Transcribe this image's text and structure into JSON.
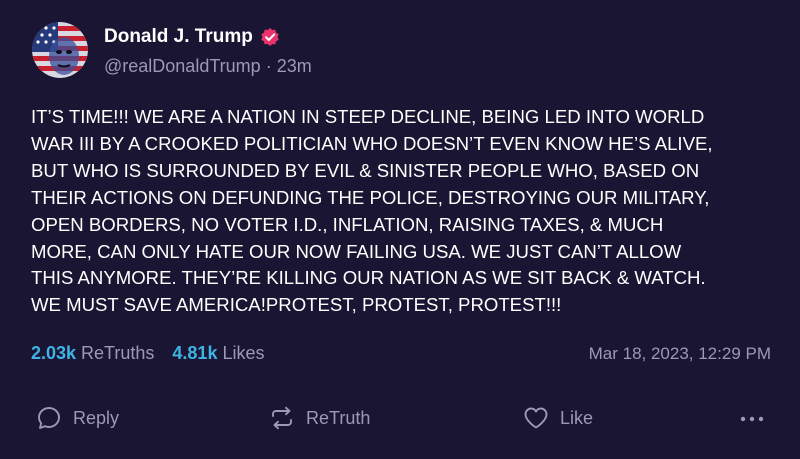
{
  "author": {
    "display_name": "Donald J. Trump",
    "handle": "@realDonaldTrump",
    "separator": "·",
    "relative_time": "23m",
    "verified": true
  },
  "post": {
    "text": "IT’S TIME!!! WE ARE A NATION IN STEEP DECLINE, BEING LED INTO WORLD\nWAR III BY A CROOKED POLITICIAN WHO DOESN’T EVEN KNOW HE’S ALIVE,\nBUT WHO IS SURROUNDED BY EVIL & SINISTER PEOPLE WHO, BASED ON\nTHEIR ACTIONS ON DEFUNDING THE POLICE, DESTROYING OUR MILITARY,\nOPEN BORDERS, NO VOTER I.D., INFLATION, RAISING TAXES, & MUCH\nMORE, CAN ONLY HATE OUR NOW FAILING USA. WE JUST CAN’T ALLOW\nTHIS ANYMORE. THEY’RE  KILLING OUR NATION AS WE SIT BACK & WATCH.\nWE MUST SAVE AMERICA!PROTEST, PROTEST, PROTEST!!!"
  },
  "stats": {
    "retruths_count": "2.03k",
    "retruths_label": "ReTruths",
    "likes_count": "4.81k",
    "likes_label": "Likes",
    "timestamp": "Mar 18, 2023, 12:29 PM"
  },
  "actions": {
    "reply_label": "Reply",
    "retruth_label": "ReTruth",
    "like_label": "Like"
  },
  "icons": {
    "reply": "speech-bubble-icon",
    "retruth": "repost-arrows-icon",
    "like": "heart-icon",
    "more": "ellipsis-icon",
    "verified": "verified-badge-icon"
  },
  "colors": {
    "background": "#1a1532",
    "text": "#ffffff",
    "muted": "#9c98b6",
    "accent": "#3fb3e6",
    "verified_badge": "#e8336b"
  }
}
